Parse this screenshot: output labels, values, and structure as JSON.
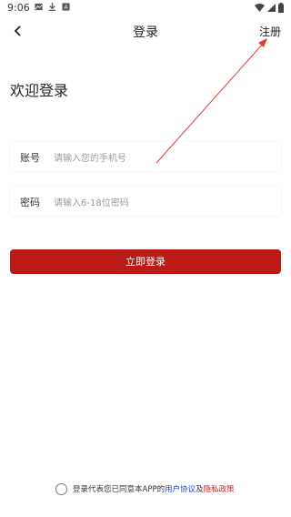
{
  "status_bar": {
    "time": "9:06"
  },
  "nav": {
    "title": "登录",
    "register_label": "注册"
  },
  "welcome_title": "欢迎登录",
  "account_field": {
    "label": "账号",
    "placeholder": "请输入您的手机号"
  },
  "password_field": {
    "label": "密码",
    "placeholder": "请输入6-18位密码"
  },
  "login_button": {
    "label": "立即登录"
  },
  "agreement": {
    "prefix": "登录代表您已同意本APP的",
    "user_agreement": "用户协议",
    "and": "及",
    "privacy_policy": "隐私政策"
  },
  "colors": {
    "primary": "#bb1b16",
    "link_blue": "#1a3cc7",
    "link_red": "#c81f1a",
    "annotation_arrow": "#e23b3b"
  }
}
